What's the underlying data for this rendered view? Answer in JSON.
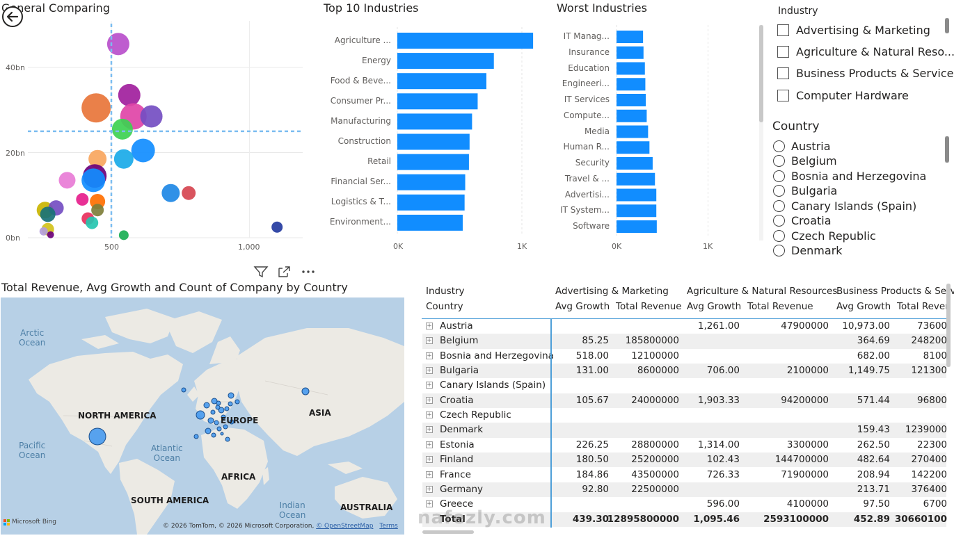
{
  "scatter": {
    "title": "General Comparing",
    "y_ticks": [
      "40bn",
      "20bn",
      "0bn"
    ],
    "x_ticks": [
      "500",
      "1,000"
    ],
    "bubbles": [
      {
        "x": 525,
        "y": 45.5,
        "r": 16,
        "color": "#B84FCB"
      },
      {
        "x": 565,
        "y": 33.5,
        "r": 16,
        "color": "#A1209D"
      },
      {
        "x": 445,
        "y": 30.5,
        "r": 21,
        "color": "#E8753A"
      },
      {
        "x": 580,
        "y": 28.5,
        "r": 19,
        "color": "#E044A7"
      },
      {
        "x": 645,
        "y": 28.5,
        "r": 16,
        "color": "#744EC2"
      },
      {
        "x": 540,
        "y": 25.5,
        "r": 15,
        "color": "#3DD151"
      },
      {
        "x": 615,
        "y": 20.5,
        "r": 17,
        "color": "#118DFF"
      },
      {
        "x": 545,
        "y": 18.5,
        "r": 14,
        "color": "#1AAAE8"
      },
      {
        "x": 450,
        "y": 18.5,
        "r": 13,
        "color": "#F8A65E"
      },
      {
        "x": 340,
        "y": 13.5,
        "r": 12,
        "color": "#E87CD6"
      },
      {
        "x": 440,
        "y": 14.5,
        "r": 17,
        "color": "#6B007B"
      },
      {
        "x": 435,
        "y": 13.5,
        "r": 17,
        "color": "#118DFF"
      },
      {
        "x": 715,
        "y": 10.5,
        "r": 13,
        "color": "#1E88E5"
      },
      {
        "x": 780,
        "y": 10.5,
        "r": 10,
        "color": "#D64550"
      },
      {
        "x": 395,
        "y": 9.0,
        "r": 9,
        "color": "#E61E8C"
      },
      {
        "x": 450,
        "y": 8.5,
        "r": 11,
        "color": "#FF6F00"
      },
      {
        "x": 260,
        "y": 6.5,
        "r": 12,
        "color": "#C9B400"
      },
      {
        "x": 300,
        "y": 7.0,
        "r": 11,
        "color": "#744EC2"
      },
      {
        "x": 270,
        "y": 5.5,
        "r": 11,
        "color": "#197278"
      },
      {
        "x": 450,
        "y": 6.5,
        "r": 9,
        "color": "#7E7E3A"
      },
      {
        "x": 415,
        "y": 4.5,
        "r": 9,
        "color": "#E8305C"
      },
      {
        "x": 430,
        "y": 3.5,
        "r": 9,
        "color": "#26C6B0"
      },
      {
        "x": 270,
        "y": 2.0,
        "r": 9,
        "color": "#D2C21B"
      },
      {
        "x": 255,
        "y": 1.5,
        "r": 6,
        "color": "#B39DDB"
      },
      {
        "x": 280,
        "y": 0.7,
        "r": 5,
        "color": "#6B007B"
      },
      {
        "x": 545,
        "y": 0.6,
        "r": 7,
        "color": "#1AAF54"
      },
      {
        "x": 1100,
        "y": 2.5,
        "r": 8,
        "color": "#243BA0"
      }
    ],
    "x_ref": 500,
    "y_ref": 25
  },
  "top10": {
    "title": "Top 10 Industries",
    "categories": [
      "Agriculture ...",
      "Energy",
      "Food & Beve...",
      "Consumer Pr...",
      "Manufacturing",
      "Construction",
      "Retail",
      "Financial Ser...",
      "Logistics & T...",
      "Environment..."
    ],
    "values": [
      1090,
      775,
      715,
      645,
      600,
      580,
      575,
      545,
      540,
      525
    ],
    "x_ticks": [
      "0K",
      "1K"
    ],
    "color": "#118DFF"
  },
  "worst": {
    "title": "Worst Industries",
    "categories": [
      "IT Manag...",
      "Insurance",
      "Education",
      "Engineeri...",
      "IT Services",
      "Compute...",
      "Media",
      "Human R...",
      "Security",
      "Travel & ...",
      "Advertisi...",
      "IT System...",
      "Software"
    ],
    "values": [
      290,
      295,
      310,
      315,
      320,
      330,
      345,
      360,
      395,
      420,
      435,
      435,
      440
    ],
    "x_ticks": [
      "0K",
      "1K"
    ],
    "color": "#118DFF"
  },
  "industry_slicer": {
    "header": "Industry",
    "items": [
      "Advertising & Marketing",
      "Agriculture & Natural Reso...",
      "Business Products & Services",
      "Computer Hardware"
    ]
  },
  "country_slicer": {
    "header": "Country",
    "items": [
      "Austria",
      "Belgium",
      "Bosnia and Herzegovina",
      "Bulgaria",
      "Canary Islands (Spain)",
      "Croatia",
      "Czech Republic",
      "Denmark"
    ]
  },
  "map": {
    "title": "Total Revenue, Avg Growth and Count of Company by Country",
    "labels": {
      "north_america": "NORTH AMERICA",
      "europe": "EUROPE",
      "asia": "ASIA",
      "africa": "AFRICA",
      "south_america": "SOUTH AMERICA",
      "australia": "AUSTRALIA"
    },
    "oceans": {
      "arctic": "Arctic\nOcean",
      "atlantic": "Atlantic\nOcean",
      "pacific": "Pacific\nOcean",
      "indian": "Indian\nOcean"
    },
    "attribution": "© 2026 TomTom, © 2026 Microsoft Corporation,",
    "attribution_link": "© OpenStreetMap",
    "terms": "Terms",
    "bing": "Microsoft Bing"
  },
  "matrix": {
    "row_header_1": "Industry",
    "row_header_2": "Country",
    "industry_headers": [
      "Advertising & Marketing",
      "Agriculture & Natural Resources",
      "Business Products & Serv"
    ],
    "measure_headers": [
      "Avg Growth",
      "Total Revenue",
      "Avg Growth",
      "Total Revenue",
      "Avg Growth",
      "Total Reven"
    ],
    "rows": [
      {
        "country": "Austria",
        "cells": [
          "",
          "",
          "1,261.00",
          "47900000",
          "10,973.00",
          "73600"
        ]
      },
      {
        "country": "Belgium",
        "cells": [
          "85.25",
          "185800000",
          "",
          "",
          "364.69",
          "248200"
        ]
      },
      {
        "country": "Bosnia and Herzegovina",
        "cells": [
          "518.00",
          "12100000",
          "",
          "",
          "682.00",
          "8100"
        ]
      },
      {
        "country": "Bulgaria",
        "cells": [
          "131.00",
          "8600000",
          "706.00",
          "2100000",
          "1,149.75",
          "121300"
        ]
      },
      {
        "country": "Canary Islands (Spain)",
        "cells": [
          "",
          "",
          "",
          "",
          "",
          ""
        ]
      },
      {
        "country": "Croatia",
        "cells": [
          "105.67",
          "24000000",
          "1,903.33",
          "94200000",
          "571.44",
          "96800"
        ]
      },
      {
        "country": "Czech Republic",
        "cells": [
          "",
          "",
          "",
          "",
          "",
          ""
        ]
      },
      {
        "country": "Denmark",
        "cells": [
          "",
          "",
          "",
          "",
          "159.43",
          "1239000"
        ]
      },
      {
        "country": "Estonia",
        "cells": [
          "226.25",
          "28800000",
          "1,314.00",
          "3300000",
          "262.50",
          "22300"
        ]
      },
      {
        "country": "Finland",
        "cells": [
          "180.50",
          "25200000",
          "102.43",
          "144700000",
          "482.64",
          "270400"
        ]
      },
      {
        "country": "France",
        "cells": [
          "184.86",
          "43500000",
          "726.33",
          "71900000",
          "208.94",
          "142200"
        ]
      },
      {
        "country": "Germany",
        "cells": [
          "92.80",
          "22500000",
          "",
          "",
          "213.71",
          "376400"
        ]
      },
      {
        "country": "Greece",
        "cells": [
          "",
          "",
          "596.00",
          "4100000",
          "97.50",
          "6700"
        ]
      }
    ],
    "total": {
      "label": "Total",
      "cells": [
        "439.30",
        "12895800000",
        "1,095.46",
        "2593100000",
        "452.89",
        "30660100"
      ]
    }
  },
  "watermark": "nafezly.com"
}
